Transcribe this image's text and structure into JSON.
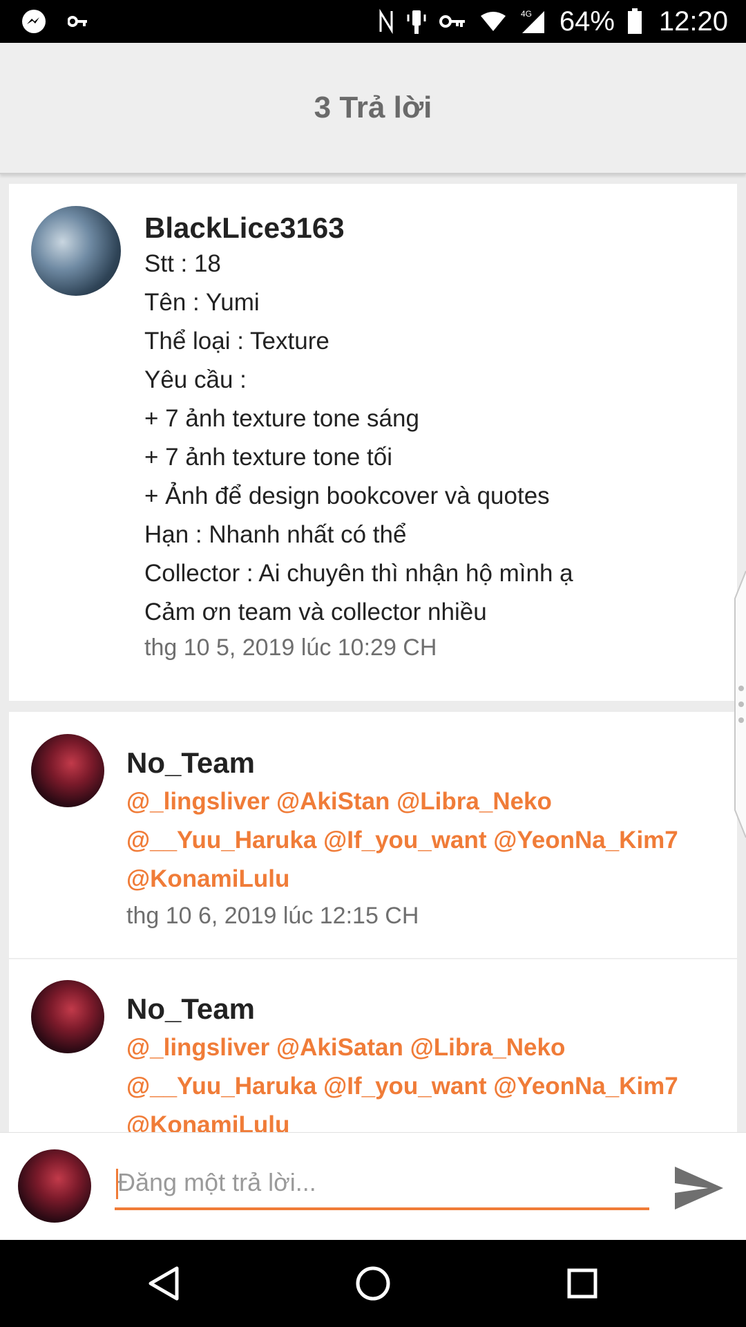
{
  "status_bar": {
    "battery": "64%",
    "time": "12:20",
    "network": "4G",
    "icons": [
      "messenger-icon",
      "key-icon",
      "nfc-icon",
      "vibrate-icon",
      "vpn-key-icon",
      "wifi-icon",
      "cell-signal-icon",
      "battery-icon"
    ]
  },
  "header": {
    "title": "3 Trả lời"
  },
  "replies": [
    {
      "username": "BlackLice3163",
      "lines": [
        "Stt : 18",
        "Tên : Yumi",
        "Thể loại : Texture",
        "Yêu cầu :",
        "+ 7 ảnh texture tone sáng",
        "+ 7 ảnh texture tone tối",
        "+ Ảnh để design bookcover và quotes",
        "Hạn : Nhanh nhất có thể",
        "Collector : Ai chuyên thì nhận hộ mình ạ",
        "Cảm ơn team và collector nhiều"
      ],
      "timestamp": "thg 10 5, 2019 lúc 10:29 CH"
    },
    {
      "username": "No_Team",
      "mention_lines": [
        "@_lingsliver @AkiStan @Libra_Neko",
        "@__Yuu_Haruka @If_you_want @YeonNa_Kim7",
        "@KonamiLulu"
      ],
      "timestamp": "thg 10 6, 2019 lúc 12:15 CH"
    },
    {
      "username": "No_Team",
      "mention_lines": [
        "@_lingsliver @AkiSatan @Libra_Neko",
        "@__Yuu_Haruka @If_you_want @YeonNa_Kim7",
        "@KonamiLulu"
      ]
    }
  ],
  "compose": {
    "placeholder": "Đăng một trả lời...",
    "send_icon": "send-icon"
  },
  "nav": {
    "icons": [
      "back-triangle-icon",
      "home-circle-icon",
      "recents-square-icon"
    ]
  },
  "colors": {
    "accent": "#f07c38",
    "header_bg": "#eeeeee",
    "text": "#222222",
    "timestamp": "#6f6f6f"
  }
}
